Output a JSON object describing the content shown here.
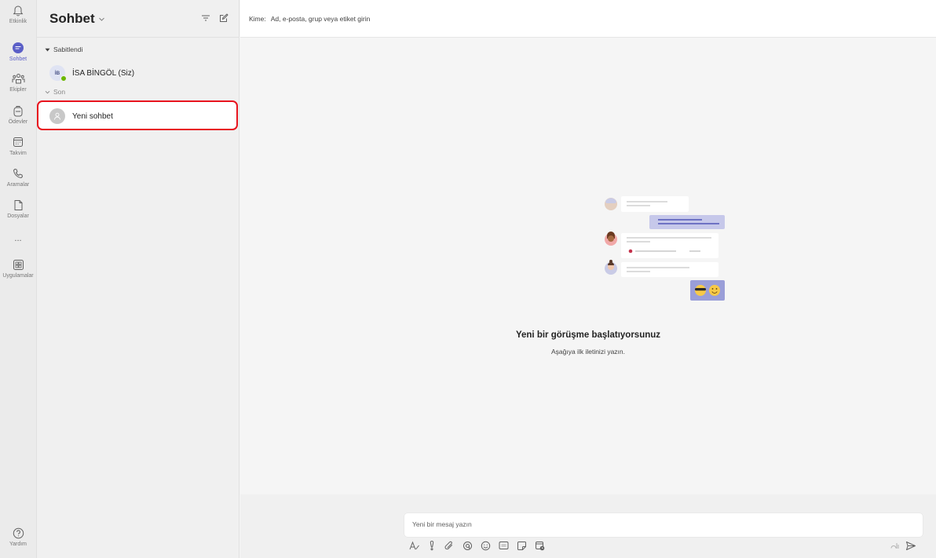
{
  "rail": {
    "items": [
      {
        "label": "Etkinlik",
        "icon": "bell-icon"
      },
      {
        "label": "Sohbet",
        "icon": "chat-icon"
      },
      {
        "label": "Ekipler",
        "icon": "teams-icon"
      },
      {
        "label": "Ödevler",
        "icon": "backpack-icon"
      },
      {
        "label": "Takvim",
        "icon": "calendar-icon"
      },
      {
        "label": "Aramalar",
        "icon": "phone-icon"
      },
      {
        "label": "Dosyalar",
        "icon": "file-icon"
      },
      {
        "label": "Uygulamalar",
        "icon": "apps-icon"
      },
      {
        "label": "Yardım",
        "icon": "help-icon"
      }
    ],
    "more": "..."
  },
  "list": {
    "title": "Sohbet",
    "sections": {
      "pinned": "Sabitlendi",
      "recent": "Son"
    },
    "pinned_chat": {
      "initials": "İB",
      "name": "İSA BİNGÖL (Siz)",
      "presence": "available"
    },
    "recent_chat": {
      "name": "Yeni sohbet"
    }
  },
  "main": {
    "to_label": "Kime:",
    "to_placeholder": "Ad, e-posta, grup veya etiket girin",
    "empty_title": "Yeni bir görüşme başlatıyorsunuz",
    "empty_subtitle": "Aşağıya ilk iletinizi yazın.",
    "compose_placeholder": "Yeni bir mesaj yazın"
  },
  "colors": {
    "accent": "#5b5fc7",
    "highlight_border": "#e8141e",
    "presence_available": "#6bb700"
  }
}
